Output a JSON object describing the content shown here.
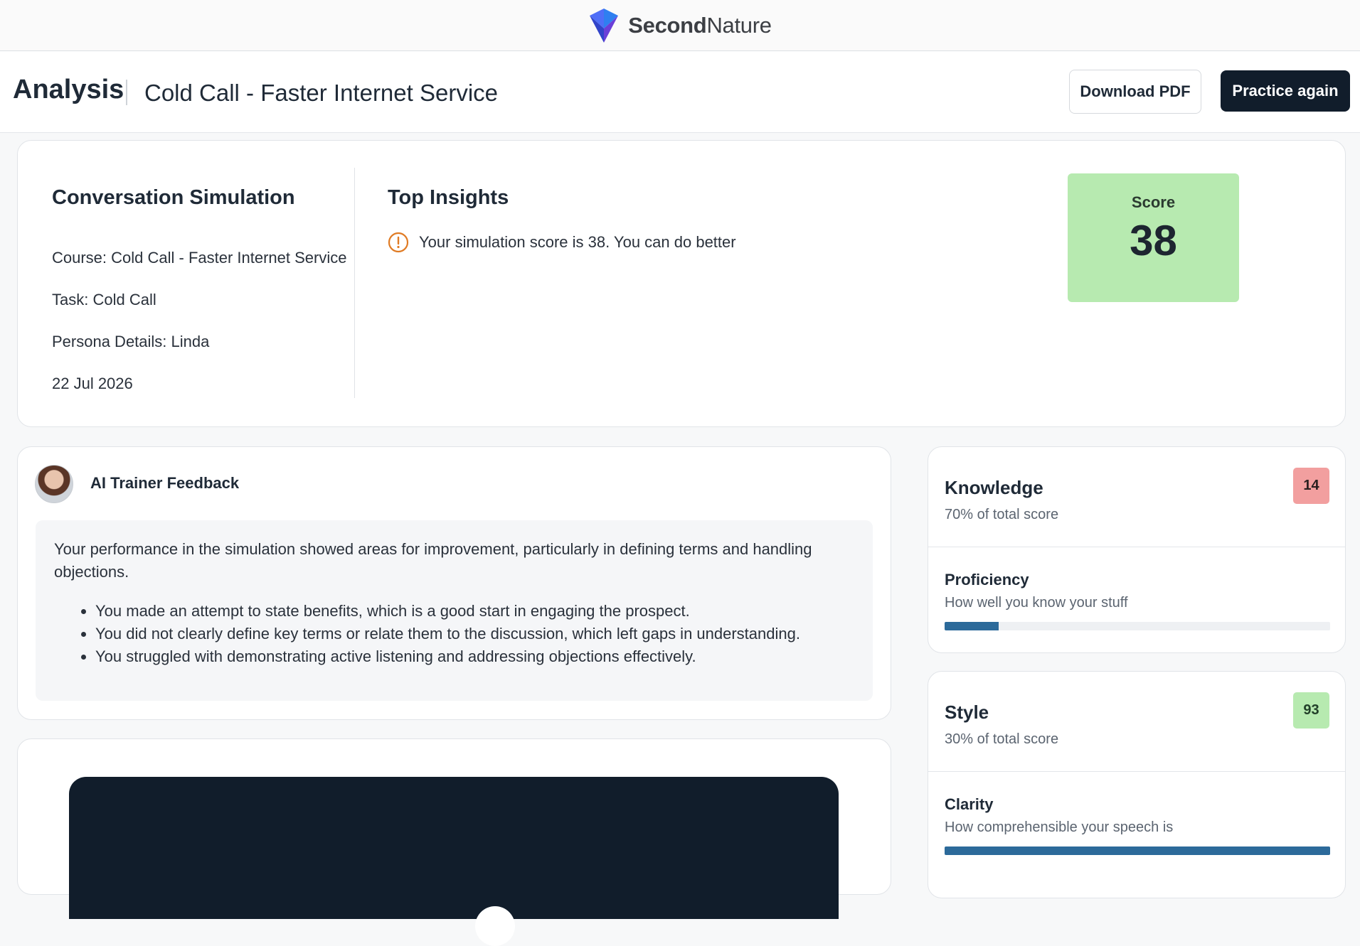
{
  "brand": {
    "name_bold": "Second",
    "name_rest": "Nature",
    "accent": "#3b5bdb"
  },
  "header": {
    "title": "Analysis",
    "subtitle": "Cold Call - Faster Internet Service",
    "download_label": "Download PDF",
    "practice_label": "Practice again"
  },
  "summary": {
    "title": "Conversation Simulation",
    "course": "Course: Cold Call - Faster Internet Service",
    "task": "Task: Cold Call",
    "persona": "Persona Details: Linda",
    "date": "22 Jul 2026",
    "insights_title": "Top Insights",
    "insight_icon": "warning-icon",
    "insight_text": "Your simulation score is 38. You can do better",
    "score_label": "Score",
    "score_value": "38",
    "score_color": "#b7eab0"
  },
  "feedback": {
    "title": "AI Trainer Feedback",
    "paragraph": "Your performance in the simulation showed areas for improvement, particularly in defining terms and handling objections.",
    "bullets": [
      "You made an attempt to state benefits, which is a good start in engaging the prospect.",
      "You did not clearly define key terms or relate them to the discussion, which left gaps in understanding.",
      "You struggled with demonstrating active listening and addressing objections effectively."
    ]
  },
  "knowledge": {
    "title": "Knowledge",
    "weight": "70% of total score",
    "score": "14",
    "badge_color": "#f29f9f",
    "sub_title": "Proficiency",
    "sub_desc": "How well you know your stuff",
    "progress_fraction": 0.14
  },
  "style": {
    "title": "Style",
    "weight": "30% of total score",
    "score": "93",
    "badge_color": "#b7eab0",
    "sub_title": "Clarity",
    "sub_desc": "How comprehensible your speech is",
    "progress_fraction": 1.0
  }
}
